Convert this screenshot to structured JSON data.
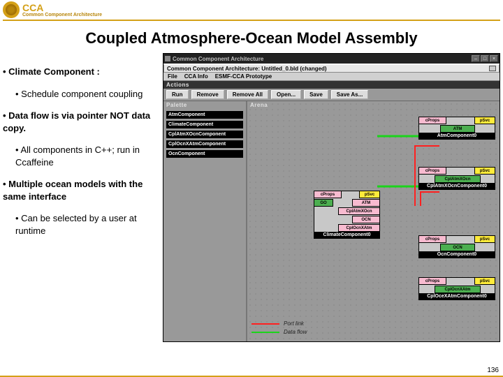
{
  "branding": {
    "acronym": "CCA",
    "name": "Common Component Architecture"
  },
  "slide": {
    "title": "Coupled Atmosphere-Ocean Model Assembly",
    "page_number": "136"
  },
  "bullets": {
    "b1": "• Climate Component :",
    "b1a": "• Schedule component coupling",
    "b2": "• Data flow is via pointer NOT data copy.",
    "b2a": "• All components in C++; run in Ccaffeine",
    "b3": "• Multiple ocean models with the same interface",
    "b3a": "• Can be selected by a user at runtime"
  },
  "app": {
    "window_title": "Common Component Architecture",
    "doc_title": "Common Component Architecture: Untitled_0.bld (changed)",
    "menu": {
      "file": "File",
      "ccainfo": "CCA Info",
      "esmf": "ESMF-CCA Prototype"
    },
    "actions_label": "Actions",
    "toolbar": {
      "run": "Run",
      "remove": "Remove",
      "remove_all": "Remove All",
      "open": "Open...",
      "save": "Save",
      "save_as": "Save As..."
    },
    "palette_label": "Palette",
    "arena_label": "Arena",
    "palette_items": [
      "AtmComponent",
      "ClimateComponent",
      "CplAtmXOcnComponent",
      "CplOcnXAtmComponent",
      "OcnComponent"
    ],
    "legend": {
      "portlink": "Port link",
      "dataflow": "Data flow"
    }
  },
  "components": {
    "atm": {
      "name": "AtmComponent0",
      "ports": {
        "cprops": "cProps",
        "psvc": "pSvc",
        "atm": "ATM"
      }
    },
    "cplAO": {
      "name": "CplAtmXOcnComponent0",
      "ports": {
        "cprops": "cProps",
        "psvc": "pSvc",
        "cplatmxocn": "CplAtmXOcn"
      }
    },
    "climate": {
      "name": "ClimateComponent0",
      "ports": {
        "cprops": "cProps",
        "psvc": "pSvc",
        "go": "GO",
        "atm": "ATM",
        "cplatmxocn": "CplAtmXOcn",
        "ocn": "OCN",
        "cplocnxatm": "CplOcnXAtm"
      }
    },
    "ocn": {
      "name": "OcnComponent0",
      "ports": {
        "cprops": "cProps",
        "psvc": "pSvc",
        "ocn": "OCN"
      }
    },
    "cplOA": {
      "name": "CplOceXAtmComponent0",
      "ports": {
        "cprops": "cProps",
        "psvc": "pSvc",
        "cplocnxatm": "CplOcnXAtm"
      }
    }
  }
}
